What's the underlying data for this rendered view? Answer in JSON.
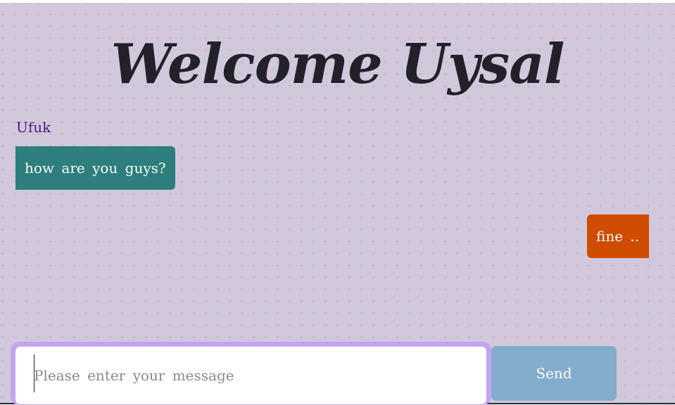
{
  "header": {
    "title": "Welcome Uysal"
  },
  "messages": [
    {
      "sender": "Ufuk",
      "text": "how are you guys?",
      "direction": "incoming",
      "color": "#2c7f7d"
    },
    {
      "sender": "",
      "text": "fine ..",
      "direction": "outgoing",
      "color": "#cf4c00"
    }
  ],
  "composer": {
    "placeholder": "Please enter your message",
    "value": "",
    "send_label": "Send"
  },
  "colors": {
    "background": "#e0d6e8",
    "title": "#22212a",
    "sender_name": "#4b1a80",
    "input_focus_ring": "#c4a3ef",
    "send_button": "#83adcc"
  }
}
